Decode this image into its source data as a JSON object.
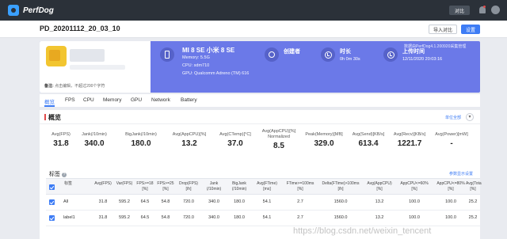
{
  "app": {
    "logo_text": "PerfDog",
    "top_button": "对比"
  },
  "titlebar": {
    "title": "PD_20201112_20_03_10",
    "export_label": "导入对比",
    "settings_label": "设置"
  },
  "banner": {
    "note_label": "备注:",
    "note_value": "点击编辑，不超过200个字符",
    "right_note": "数据由PerfDog4.1.200920采集管理",
    "device": {
      "name": "MI 8 SE 小米 8 SE",
      "memory": "Memory: 5.5G",
      "cpu": "CPU: sdm710",
      "gpu": "GPU: Qualcomm Adreno (TM) 616"
    },
    "creator": {
      "title": "创建者",
      "value": ""
    },
    "duration": {
      "title": "时长",
      "value": "0h 0m 30s"
    },
    "upload": {
      "title": "上传时间",
      "value": "12/11/2020 20:03:16"
    }
  },
  "tabs": [
    "概览",
    "FPS",
    "CPU",
    "Memory",
    "GPU",
    "Network",
    "Battery"
  ],
  "overview": {
    "title": "概览",
    "link": "单位全部",
    "stats": [
      {
        "label": "Avg(FPS)",
        "value": "31.8"
      },
      {
        "label": "Jank(/10min)",
        "value": "340.0"
      },
      {
        "label": "BigJank(/10min)",
        "value": "180.0"
      },
      {
        "label": "Avg(AppCPU)[%]",
        "value": "13.2"
      },
      {
        "label": "Avg(CTemp)[°C]",
        "value": "37.0"
      },
      {
        "label": "Avg(AppCPU)[%]\nNormalized",
        "value": "8.5"
      },
      {
        "label": "Peak(Memory)[MB]",
        "value": "329.0"
      },
      {
        "label": "Avg(Send)[KB/s]",
        "value": "613.4"
      },
      {
        "label": "Avg(Recv)[KB/s]",
        "value": "1221.7"
      },
      {
        "label": "Avg(Power)[mW]",
        "value": "-"
      }
    ]
  },
  "labels": {
    "title": "标签",
    "link": "参数显示设置",
    "columns": [
      "标签",
      "Avg(FPS)",
      "Var(FPS)",
      "FPS>=18\n[%]",
      "FPS>=25\n[%]",
      "Drop(FPS)\n[/h]",
      "Jank\n(/10min)",
      "BigJank\n(/10min)",
      "Avg(FTime)\n[ms]",
      "FTime>=100ms\n[%]",
      "Delta(FTime)>100ms\n[/h]",
      "Avg(AppCPU)\n[%]",
      "AppCPU<=60%\n[%]",
      "AppCPU<=80%\n[%]",
      "Avg(Tota\n[%]"
    ],
    "rows": [
      {
        "name": "All",
        "cells": [
          "31.8",
          "595.2",
          "64.5",
          "54.8",
          "720.0",
          "340.0",
          "180.0",
          "54.1",
          "2.7",
          "1560.0",
          "13.2",
          "100.0",
          "100.0",
          "25.2"
        ]
      },
      {
        "name": "label1",
        "cells": [
          "31.8",
          "595.2",
          "64.5",
          "54.8",
          "720.0",
          "340.0",
          "180.0",
          "54.1",
          "2.7",
          "1560.0",
          "13.2",
          "100.0",
          "100.0",
          "25.2"
        ]
      }
    ]
  },
  "watermark": "https://blog.csdn.net/weixin_tencent"
}
